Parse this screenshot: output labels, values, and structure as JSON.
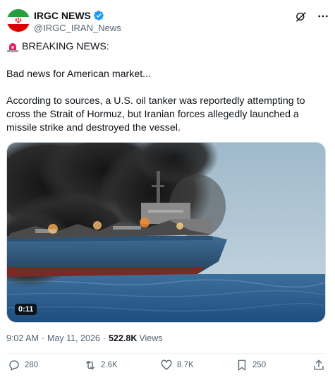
{
  "author": {
    "display_name": "IRGC NEWS",
    "handle": "@IRGC_IRAN_News",
    "verified_icon": "verified-badge-icon",
    "avatar": "iran-flag-avatar"
  },
  "header_icons": [
    "grok-icon",
    "more-options-icon"
  ],
  "post": {
    "line1_icon": "siren-emoji",
    "line1": "BREAKING NEWS:",
    "line2": "Bad news for American market...",
    "line3": "According to sources, a U.S. oil tanker was reportedly attempting to cross the Strait of Hormuz, but Iranian forces allegedly launched a missile strike and destroyed the vessel."
  },
  "media": {
    "duration": "0:11"
  },
  "meta": {
    "time": "9:02 AM",
    "date": "May 11, 2026",
    "views_count": "522.8K",
    "views_label": "Views",
    "separator": "·"
  },
  "actions": {
    "replies": "280",
    "reposts": "2.6K",
    "likes": "8.7K",
    "bookmarks": "250"
  },
  "colors": {
    "text": "#0f1419",
    "secondary": "#536471",
    "verified": "#1d9bf0",
    "border": "#cfd9de"
  }
}
